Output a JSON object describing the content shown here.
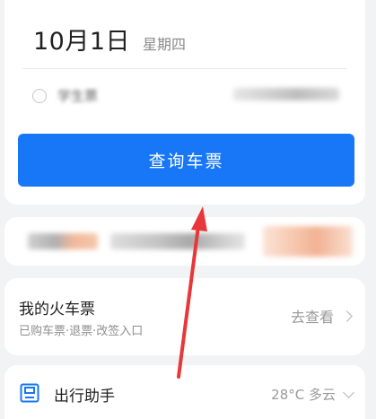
{
  "booking": {
    "date": "10月1日",
    "weekday": "星期四",
    "student_ticket_label": "学生票",
    "search_button": "查询车票"
  },
  "my_tickets": {
    "title": "我的火车票",
    "subtitle": "已购车票·退票·改签入口",
    "action": "去查看"
  },
  "assistant": {
    "title": "出行助手",
    "weather": "28°C 多云"
  },
  "colors": {
    "primary": "#1777f7",
    "annotation_arrow": "#e8373a"
  }
}
